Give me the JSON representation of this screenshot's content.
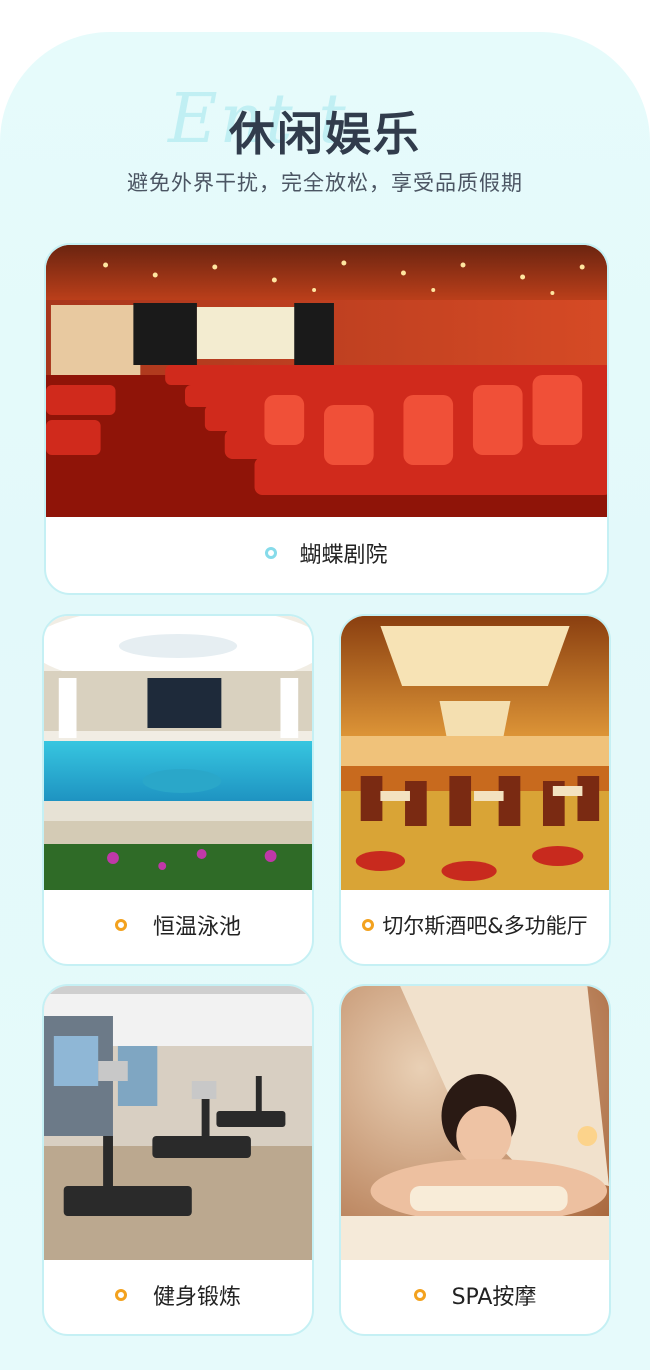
{
  "header": {
    "script_deco": "Ent t",
    "title": "休闲娱乐",
    "subtitle": "避免外界干扰，完全放松，享受品质假期"
  },
  "cards": [
    {
      "label": "蝴蝶剧院",
      "photo": "theater-photo"
    },
    {
      "label": "恒温泳池",
      "photo": "pool-photo"
    },
    {
      "label": "切尔斯酒吧&多功能厅",
      "photo": "bar-photo"
    },
    {
      "label": "健身锻炼",
      "photo": "gym-photo"
    },
    {
      "label": "SPA按摩",
      "photo": "spa-photo"
    }
  ],
  "colors": {
    "panel_bg": "#e4f9fa",
    "card_border": "#c5f0f4",
    "title": "#313c4c",
    "dot_teal": "#86dbea",
    "dot_orange": "#f3a21f"
  }
}
